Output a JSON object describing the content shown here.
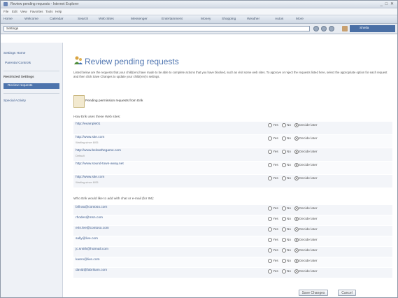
{
  "window": {
    "title": "Review pending requests - Internet Explorer"
  },
  "menu": {
    "items": [
      "File",
      "Edit",
      "View",
      "Favorites",
      "Tools",
      "Help"
    ]
  },
  "nav": {
    "items": [
      "Home",
      "Welcome",
      "Calendar",
      "Search",
      "Web Sites",
      "Messenger",
      "Entertainment",
      "Money",
      "Shopping",
      "Weather",
      "Autos",
      "More"
    ]
  },
  "address": {
    "value": "Settings",
    "user": "Sheila"
  },
  "sidebar": {
    "items": [
      {
        "label": "Settings Home"
      },
      {
        "label": "Parental Controls"
      },
      {
        "label": "Restricted Settings"
      },
      {
        "label": "Review requests"
      },
      {
        "label": "Special Activity"
      }
    ]
  },
  "page": {
    "title": "Review pending requests",
    "intro": "Listed below are the requests that your child(ren) have made to be able to complete actions that you have blocked, such as visit some web sites. To approve or reject the requests listed here, select the appropriate option for each request and then click Save Changes to update your child(ren)'s settings.",
    "pending": "Pending permission requests from Erik"
  },
  "web": {
    "section": "How Erik uses these Web sites:",
    "rows": [
      {
        "site": "http://example01",
        "sub": "",
        "choice": "decide"
      },
      {
        "site": "http://www.site.com",
        "sub": "Waiting since 8/05",
        "choice": "decide"
      },
      {
        "site": "http://www.belowthegame.com",
        "sub": "Default",
        "choice": "decide"
      },
      {
        "site": "http://www.sound-town-away.net",
        "sub": "",
        "choice": "decide"
      },
      {
        "site": "http://www.site.com",
        "sub": "Waiting since 8/05",
        "choice": "decide"
      }
    ]
  },
  "contacts": {
    "section": "Who Erik would like to add with chat or e-mail (for IM):",
    "rows": [
      {
        "site": "bill.wu@contoso.com",
        "choice": "decide"
      },
      {
        "site": "rhodes@msn.com",
        "choice": "decide"
      },
      {
        "site": "erin.lee@contoso.com",
        "choice": "decide"
      },
      {
        "site": "sally@live.com",
        "choice": "decide"
      },
      {
        "site": "jc.smith@hotmail.com",
        "choice": "decide"
      },
      {
        "site": "karen@live.com",
        "choice": "decide"
      },
      {
        "site": "david@fabrikam.com",
        "choice": "decide"
      }
    ]
  },
  "options": {
    "yes": "Yes",
    "no": "No",
    "decide": "Decide later"
  },
  "buttons": {
    "save": "Save Changes",
    "cancel": "Cancel"
  }
}
